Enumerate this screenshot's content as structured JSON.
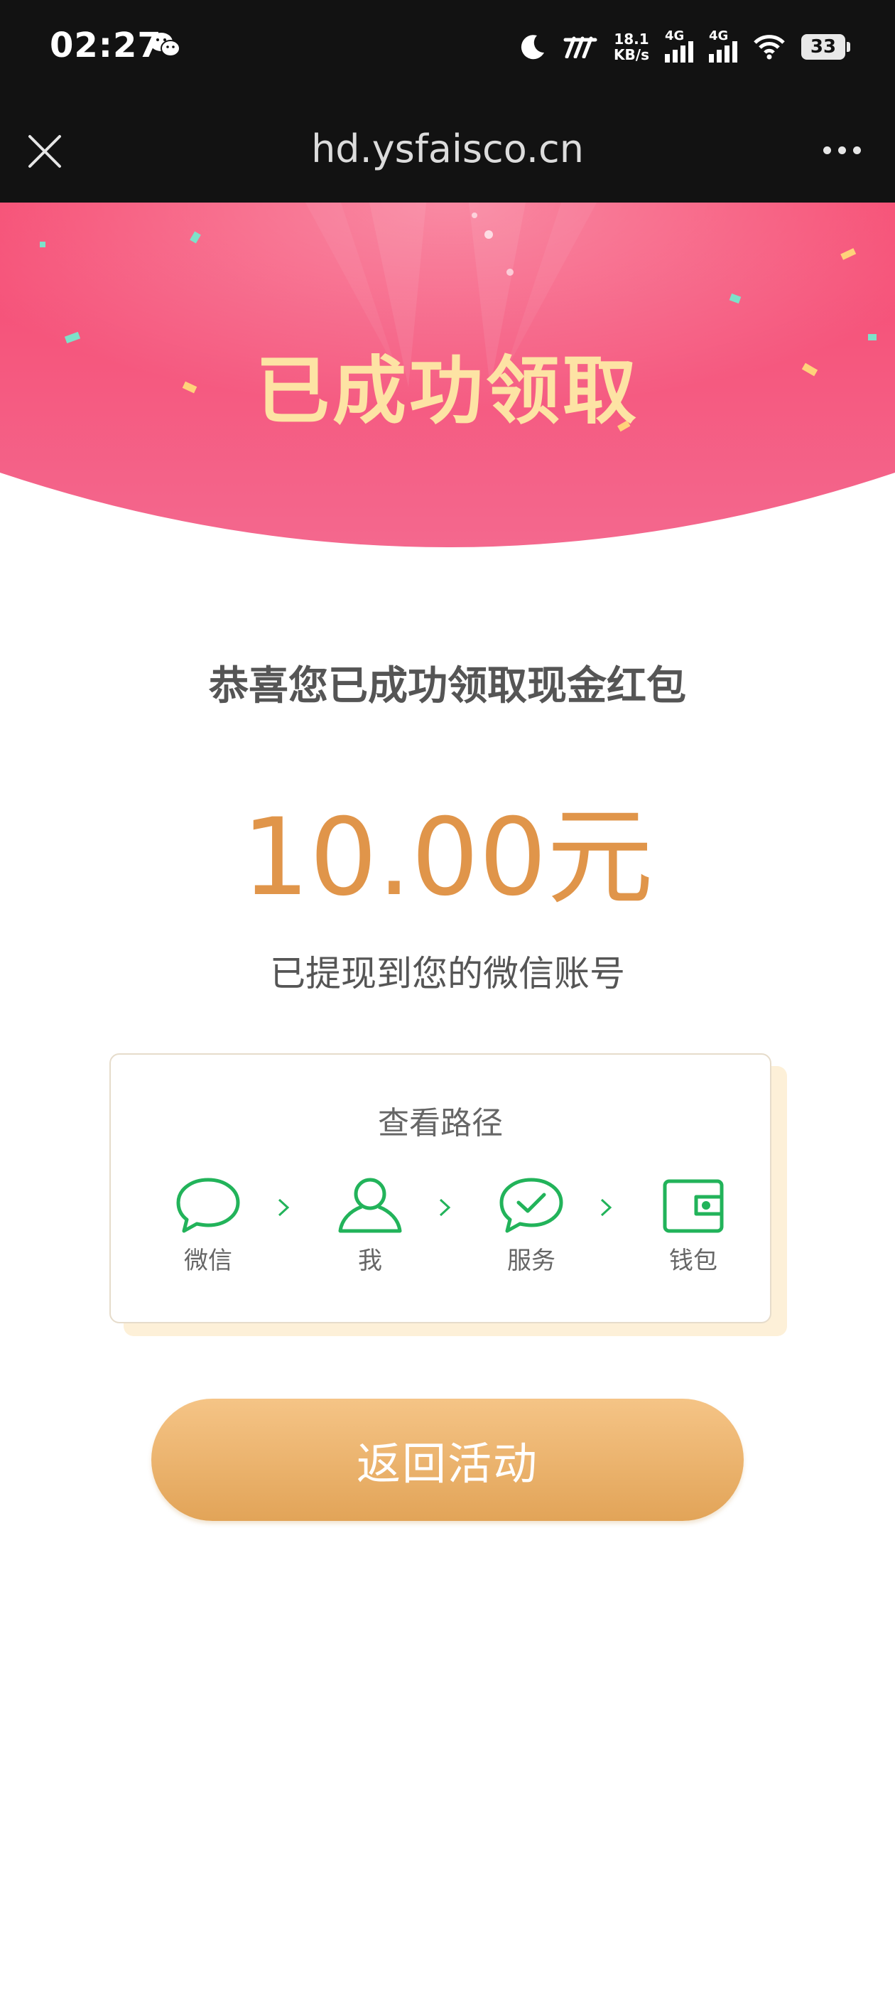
{
  "status_bar": {
    "time": "02:27",
    "net_speed_value": "18.1",
    "net_speed_unit": "KB/s",
    "network_1": "4G",
    "network_2": "4G",
    "battery": "33"
  },
  "toolbar": {
    "url": "hd.ysfaisco.cn"
  },
  "banner": {
    "title": "已成功领取"
  },
  "main": {
    "congrats": "恭喜您已成功领取现金红包",
    "amount": "10.00元",
    "withdrawn_note": "已提现到您的微信账号"
  },
  "path_card": {
    "title": "查看路径",
    "steps": [
      {
        "label": "微信",
        "icon": "chat-bubble-icon"
      },
      {
        "label": "我",
        "icon": "person-icon"
      },
      {
        "label": "服务",
        "icon": "service-check-icon"
      },
      {
        "label": "钱包",
        "icon": "wallet-icon"
      }
    ]
  },
  "button": {
    "label": "返回活动"
  },
  "colors": {
    "banner_pink": "#f5517a",
    "title_gold": "#fde3a4",
    "amount_orange": "#e0954a",
    "icon_green": "#22b35a",
    "button_top": "#f5c486",
    "button_bottom": "#e2a458"
  }
}
